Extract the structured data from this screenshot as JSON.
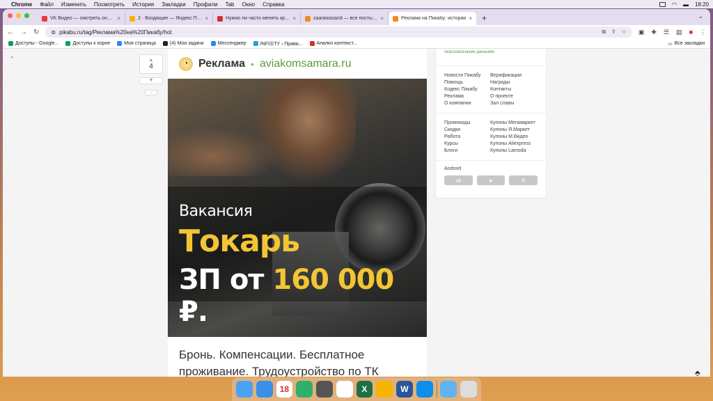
{
  "menubar": {
    "app": "Chrome",
    "items": [
      "Файл",
      "Изменить",
      "Посмотреть",
      "История",
      "Закладки",
      "Профили",
      "Tab",
      "Окно",
      "Справка"
    ],
    "time": "18:20"
  },
  "tabs": [
    {
      "title": "VK Видео — смотреть онлайн",
      "color": "#e53935",
      "active": false
    },
    {
      "title": "2 · Входящие — Яндекс Почта",
      "color": "#f4b400",
      "active": false
    },
    {
      "title": "Нужно ли часто менять кредит",
      "color": "#d32f2f",
      "active": false
    },
    {
      "title": "zaarawasarid — все посты пол",
      "color": "#f08a24",
      "active": false
    },
    {
      "title": "Реклама на Пикабу: истории",
      "color": "#f08a24",
      "active": true
    }
  ],
  "newtab": "+",
  "omnibox": {
    "url": "pikabu.ru/tag/Реклама%20на%20Пикабу/hot"
  },
  "bookmarks": [
    {
      "label": "Доступы - Google...",
      "color": "#0f9d58"
    },
    {
      "label": "Доступы к хорне",
      "color": "#0f9d58"
    },
    {
      "label": "Моя страница",
      "color": "#2787f5"
    },
    {
      "label": "(4) Мои задачи",
      "color": "#222"
    },
    {
      "label": "Мессенджер",
      "color": "#2787f5"
    },
    {
      "label": "INFI☰TY › Прави...",
      "color": "#229ed9"
    },
    {
      "label": "Анализ контекст...",
      "color": "#d32f2f"
    }
  ],
  "all_bookmarks": "Все закладки",
  "vote": {
    "up": "▲",
    "count": "4",
    "down": "▼",
    "minus": "–"
  },
  "post": {
    "category": "Реклама",
    "dot": "•",
    "site": "aviakomsamara.ru",
    "banner": {
      "line1": "Вакансия",
      "line2": "Токарь",
      "line3_prefix": "ЗП от ",
      "line3_amount": "160 000",
      "line3_suffix": " ₽."
    },
    "text": "Бронь. Компенсации. Бесплатное проживание. Трудоустройство по ТК"
  },
  "sidebar": {
    "consent": "персональными данными.",
    "col1": [
      "Новости Пикабу",
      "Помощь",
      "Кодекс Пикабу",
      "Реклама",
      "О компании"
    ],
    "col2": [
      "Верификации",
      "Награды",
      "Контакты",
      "О проекте",
      "Зал славы"
    ],
    "col3": [
      "Промокоды",
      "Скидки",
      "Работа",
      "Курсы",
      "Блоги"
    ],
    "col4": [
      "Купоны Мегамаркет",
      "Купоны Я.Маркет",
      "Купоны М.Видео",
      "Купоны Aliexpress",
      "Купоны Lamoda"
    ],
    "android": "Android",
    "social": [
      "vk",
      "tg",
      "vb"
    ]
  },
  "dock": [
    {
      "icon": "finder-icon",
      "color": "#4aa3f0"
    },
    {
      "icon": "safari-icon",
      "color": "#3a8fe8"
    },
    {
      "icon": "calendar-icon",
      "color": "#ffffff",
      "text": "18"
    },
    {
      "icon": "keychain-icon",
      "color": "#2fb06a"
    },
    {
      "icon": "screen-icon",
      "color": "#555"
    },
    {
      "icon": "yandex-icon",
      "color": "#fff"
    },
    {
      "icon": "excel-icon",
      "color": "#1d7044",
      "text": "X"
    },
    {
      "icon": "chrome-icon",
      "color": "#f4b400"
    },
    {
      "icon": "word-icon",
      "color": "#2b579a",
      "text": "W"
    },
    {
      "icon": "teamviewer-icon",
      "color": "#0e8ee9"
    },
    {
      "icon": "folder-icon",
      "color": "#5fb3ef"
    },
    {
      "icon": "trash-icon",
      "color": "#ddd"
    }
  ]
}
